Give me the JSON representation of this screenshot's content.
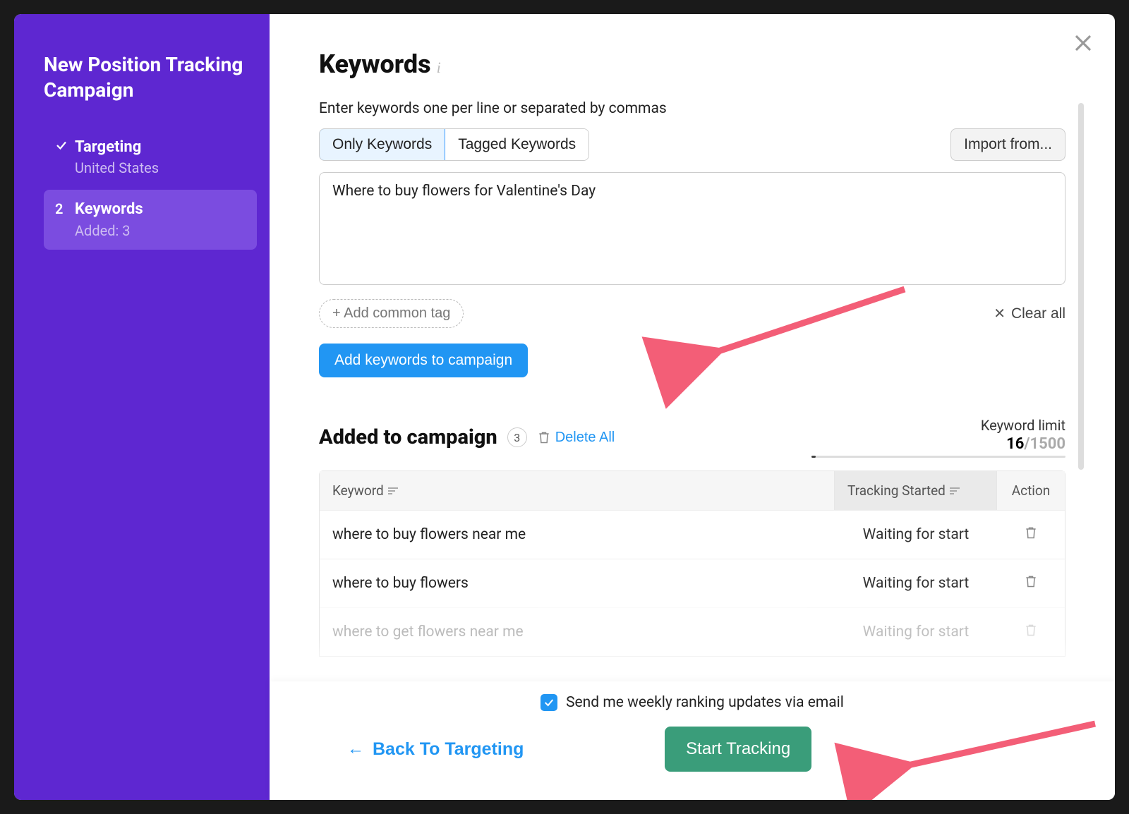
{
  "sidebar": {
    "title": "New Position Tracking Campaign",
    "steps": [
      {
        "label": "Targeting",
        "sub": "United States",
        "state": "done"
      },
      {
        "label": "Keywords",
        "sub": "Added: 3",
        "state": "active",
        "number": "2"
      }
    ]
  },
  "main": {
    "title": "Keywords",
    "instruction": "Enter keywords one per line or separated by commas",
    "tabs": {
      "only": "Only Keywords",
      "tagged": "Tagged Keywords"
    },
    "import_btn": "Import from...",
    "textarea_value": "Where to buy flowers for Valentine's Day",
    "add_tag": "+  Add common tag",
    "clear_all": "Clear all",
    "add_kw_btn": "Add keywords to campaign",
    "added_section": {
      "title": "Added to campaign",
      "count": "3",
      "delete_all": "Delete All",
      "limit_label": "Keyword limit",
      "limit_used": "16",
      "limit_max": "/1500"
    },
    "table": {
      "headers": {
        "keyword": "Keyword",
        "tracking": "Tracking Started",
        "action": "Action"
      },
      "rows": [
        {
          "kw": "where to buy flowers near me",
          "status": "Waiting for start"
        },
        {
          "kw": "where to buy flowers",
          "status": "Waiting for start"
        },
        {
          "kw": "where to get flowers near me",
          "status": "Waiting for start"
        }
      ]
    }
  },
  "footer": {
    "weekly": "Send me weekly ranking updates via email",
    "back": "Back To Targeting",
    "start": "Start Tracking"
  },
  "colors": {
    "purple": "#5e27d1",
    "purple_light": "#7b4ce0",
    "blue": "#2196f3",
    "green": "#3a9d7a",
    "arrow": "#f35e77"
  }
}
